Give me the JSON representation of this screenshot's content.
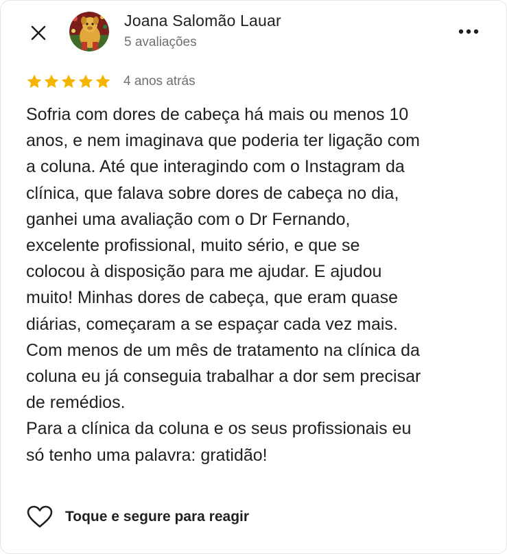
{
  "header": {
    "close_icon": "close-icon",
    "author_name": "Joana Salomão Lauar",
    "author_meta": "5 avaliações",
    "more_icon": "more-horizontal-icon"
  },
  "rating": {
    "stars": 5,
    "max_stars": 5,
    "star_color": "#f4b400",
    "date": "4 anos atrás"
  },
  "review": {
    "lines": [
      "Sofria com dores de cabeça há mais ou menos 10",
      "anos, e nem imaginava que poderia ter ligação com",
      "a coluna. Até que interagindo com o Instagram da",
      "clínica, que falava sobre dores de cabeça no dia,",
      "ganhei uma avaliação com o Dr Fernando,",
      "excelente profissional, muito sério, e que se",
      "colocou à disposição para me ajudar. E ajudou",
      "muito! Minhas dores de cabeça, que eram quase",
      "diárias, começaram a se espaçar cada vez mais.",
      "Com menos de um mês de tratamento na clínica da",
      "coluna eu já conseguia trabalhar a dor sem precisar",
      "de remédios.",
      "Para a clínica da coluna e os seus profissionais eu",
      "só tenho uma palavra: gratidão!"
    ]
  },
  "reaction": {
    "icon": "heart-outline-icon",
    "label": "Toque e segure para reagir"
  }
}
